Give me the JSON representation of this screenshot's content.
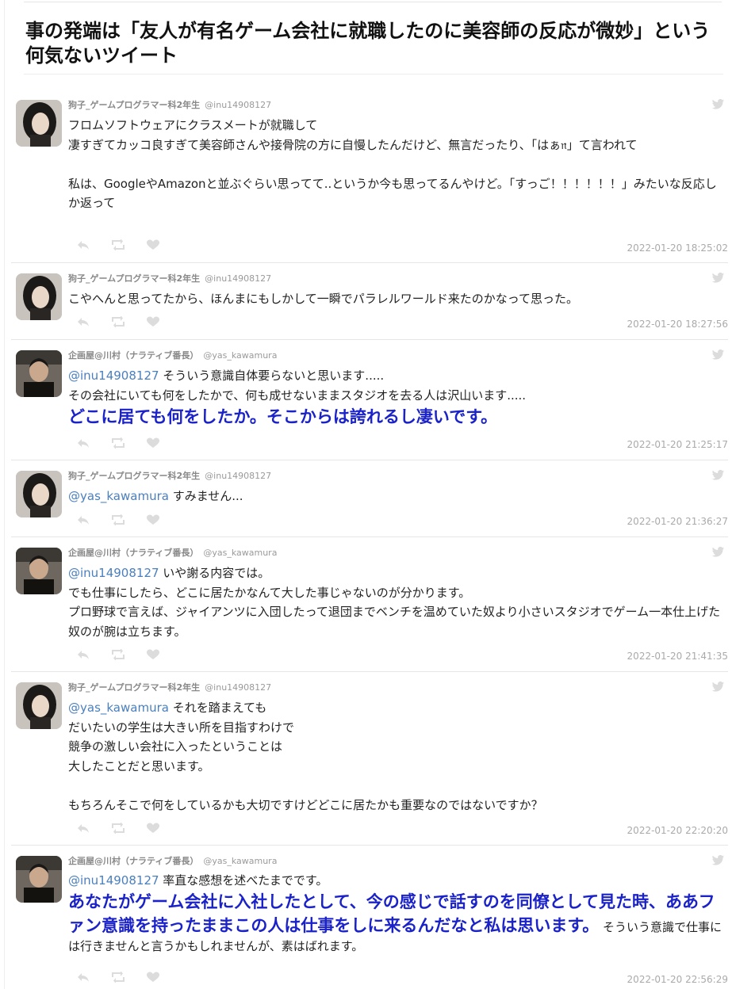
{
  "page": {
    "title": "事の発端は「友人が有名ゲーム会社に就職したのに美容師の反応が微妙」という何気ないツイート"
  },
  "users": {
    "inu": {
      "display": "狗子_ゲームプログラマー科2年生",
      "handle": "@inu14908127"
    },
    "yas": {
      "display": "企画屋@川村（ナラティブ番長）",
      "handle": "@yas_kawamura"
    }
  },
  "icons": {
    "brand": "twitter-bird-icon",
    "actions": [
      "reply-icon",
      "retweet-icon",
      "like-icon"
    ]
  },
  "colors": {
    "mention": "#4a7fbe",
    "emphasis": "#1a22c8",
    "date": "#aaaaaa",
    "icon": "#dddddd"
  },
  "tweets": [
    {
      "user": "inu",
      "display": "狗子_ゲームプログラマー科2年生",
      "handle": "@inu14908127",
      "text1": "フロムソフトウェアにクラスメートが就職して\n凄すぎてカッコ良すぎて美容師さんや接骨院の方に自慢したんだけど、無言だったり、「はぁ𝔫」て言われて\n\n私は、GoogleやAmazonと並ぶぐらい思ってて..というか今も思ってるんやけど。「すっご！！！！！！」みたいな反応しか返って",
      "date": "2022-01-20 18:25:02"
    },
    {
      "user": "inu",
      "display": "狗子_ゲームプログラマー科2年生",
      "handle": "@inu14908127",
      "text1": "こやへんと思ってたから、ほんまにもしかして一瞬でパラレルワールド来たのかなって思った。",
      "date": "2022-01-20 18:27:56"
    },
    {
      "user": "yas",
      "display": "企画屋@川村（ナラティブ番長）",
      "handle": "@yas_kawamura",
      "mention": "@inu14908127",
      "text1": " そういう意識自体要らないと思います.....\nその会社にいても何をしたかで、何も成せないままスタジオを去る人は沢山います.....\n",
      "emph": "どこに居ても何をしたか。そこからは誇れるし凄いです。",
      "date": "2022-01-20 21:25:17"
    },
    {
      "user": "inu",
      "display": "狗子_ゲームプログラマー科2年生",
      "handle": "@inu14908127",
      "mention": "@yas_kawamura",
      "text1": " すみません...",
      "date": "2022-01-20 21:36:27"
    },
    {
      "user": "yas",
      "display": "企画屋@川村（ナラティブ番長）",
      "handle": "@yas_kawamura",
      "mention": "@inu14908127",
      "text1": " いや謝る内容では。\nでも仕事にしたら、どこに居たかなんて大した事じゃないのが分かります。\nプロ野球で言えば、ジャイアンツに入団したって退団までベンチを温めていた奴より小さいスタジオでゲーム一本仕上げた奴のが腕は立ちます。",
      "date": "2022-01-20 21:41:35"
    },
    {
      "user": "inu",
      "display": "狗子_ゲームプログラマー科2年生",
      "handle": "@inu14908127",
      "mention": "@yas_kawamura",
      "text1": " それを踏まえても\nだいたいの学生は大きい所を目指すわけで\n競争の激しい会社に入ったということは\n大したことだと思います。\n\nもちろんそこで何をしているかも大切ですけどどこに居たかも重要なのではないですか？",
      "date": "2022-01-20 22:20:20"
    },
    {
      "user": "yas",
      "display": "企画屋@川村（ナラティブ番長）",
      "handle": "@yas_kawamura",
      "mention": "@inu14908127",
      "text1": " 率直な感想を述べたまでです。\n",
      "emph": "あなたがゲーム会社に入社したとして、今の感じで話すのを同僚として見た時、ああファン意識を持ったままこの人は仕事をしに来るんだなと私は思います。",
      "text2": " そういう意識で仕事には行きませんと言うかもしれませんが、素はばれます。",
      "date": "2022-01-20 22:56:29"
    }
  ]
}
